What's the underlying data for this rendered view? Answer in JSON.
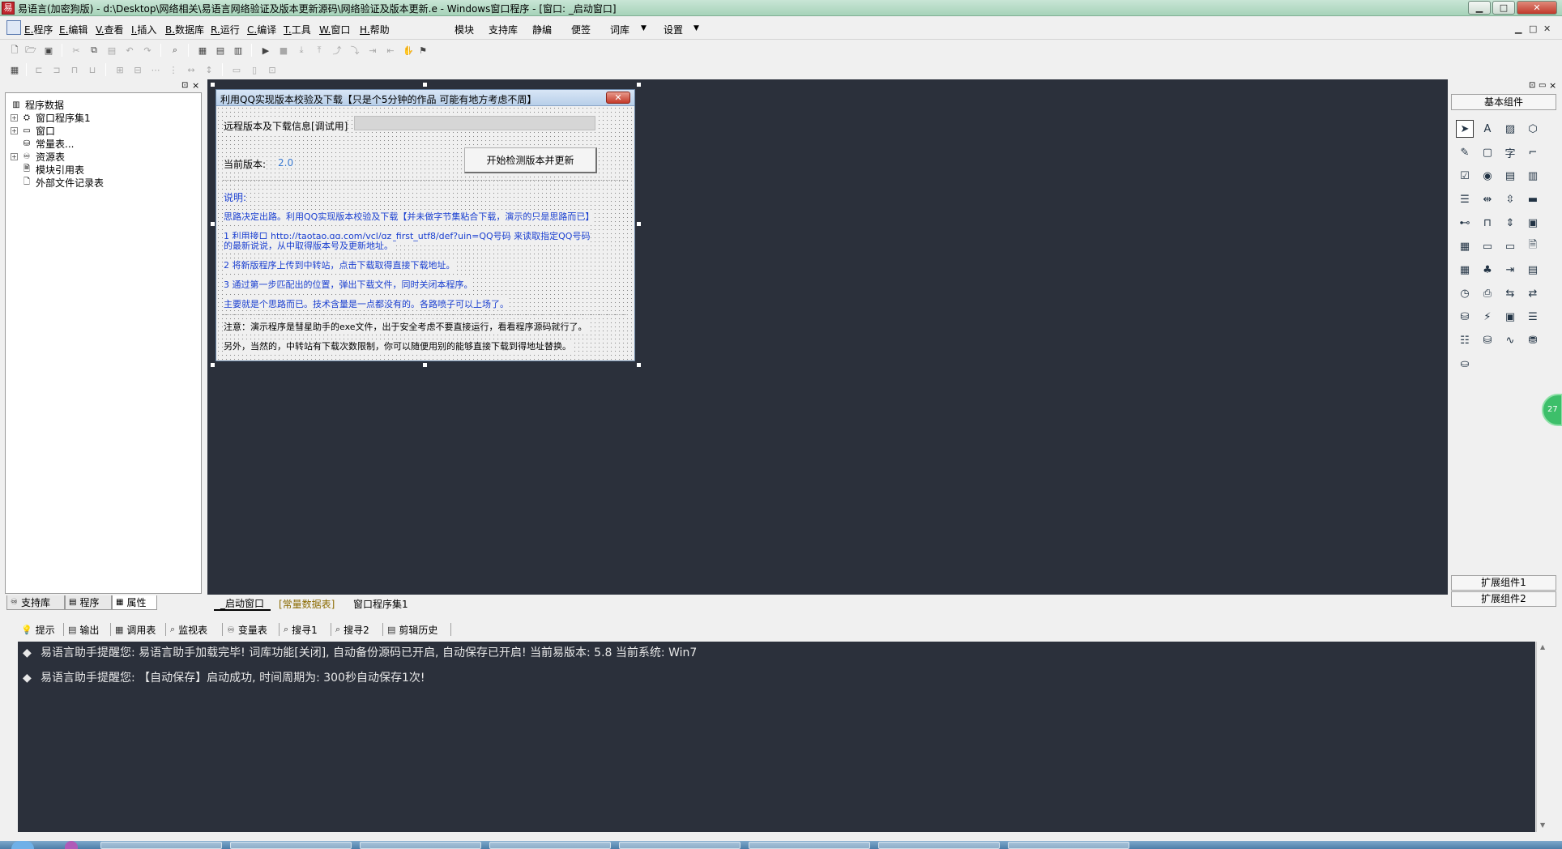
{
  "titlebar": {
    "title": "易语言(加密狗版) - d:\\Desktop\\网络相关\\易语言网络验证及版本更新源码\\网络验证及版本更新.e - Windows窗口程序 - [窗口: _启动窗口]",
    "minimize": "▁",
    "maximize": "□",
    "close": "✕"
  },
  "menu": {
    "items": [
      {
        "key": "E.",
        "label": "程序"
      },
      {
        "key": "E.",
        "label": "编辑"
      },
      {
        "key": "V.",
        "label": "查看"
      },
      {
        "key": "I.",
        "label": "插入"
      },
      {
        "key": "B.",
        "label": "数据库"
      },
      {
        "key": "R.",
        "label": "运行"
      },
      {
        "key": "C.",
        "label": "编译"
      },
      {
        "key": "T.",
        "label": "工具"
      },
      {
        "key": "W.",
        "label": "窗口"
      },
      {
        "key": "H.",
        "label": "帮助"
      }
    ],
    "extras": [
      "模块",
      "支持库",
      "静编",
      "便签",
      "词库",
      "设置"
    ],
    "dropdown_glyph": "▼"
  },
  "left_panel": {
    "root": "程序数据",
    "nodes": [
      {
        "label": "窗口程序集1",
        "expander": "+"
      },
      {
        "label": "窗口",
        "expander": "+"
      },
      {
        "label": "常量表...",
        "expander": ""
      },
      {
        "label": "资源表",
        "expander": "+"
      },
      {
        "label": "模块引用表",
        "expander": ""
      },
      {
        "label": "外部文件记录表",
        "expander": ""
      }
    ],
    "tabs": [
      "支持库",
      "程序",
      "属性"
    ]
  },
  "design_tabs": [
    "_启动窗口",
    "[常量数据表]",
    "窗口程序集1"
  ],
  "form": {
    "title": "利用QQ实现版本校验及下载【只是个5分钟的作品 可能有地方考虑不周】",
    "remote_label": "远程版本及下载信息[调试用]",
    "version_label": "当前版本:",
    "version_value": "2.0",
    "check_button": "开始检测版本并更新",
    "desc_title": "说明:",
    "desc_lines": [
      "思路决定出路。利用QQ实现版本校验及下载【并未做字节集粘合下载，演示的只是思路而已】",
      "1 利用接口 http://taotao.qq.com/vcl/qz_first_utf8/def?uin=QQ号码 来读取指定QQ号码",
      "的最新说说，从中取得版本号及更新地址。",
      "2 将新版程序上传到中转站，点击下载取得直接下载地址。",
      "3 通过第一步匹配出的位置，弹出下载文件，同时关闭本程序。",
      "主要就是个思路而已。技术含量是一点都没有的。各路喷子可以上场了。"
    ],
    "note_lines": [
      "注意：演示程序是彗星助手的exe文件，出于安全考虑不要直接运行，看看程序源码就行了。",
      "另外，当然的，中转站有下载次数限制，你可以随便用别的能够直接下载到得地址替换。"
    ]
  },
  "right_panel": {
    "header": "基本组件",
    "ext1": "扩展组件1",
    "ext2": "扩展组件2",
    "badge": "27"
  },
  "output_tabs": [
    "提示",
    "输出",
    "调用表",
    "监视表",
    "变量表",
    "搜寻1",
    "搜寻2",
    "剪辑历史"
  ],
  "output_lines": [
    "易语言助手提醒您:  易语言助手加载完毕! 词库功能[关闭], 自动备份源码已开启, 自动保存已开启!  当前易版本: 5.8  当前系统: Win7",
    "易语言助手提醒您: 【自动保存】启动成功, 时间周期为: 300秒自动保存1次!"
  ],
  "colors": {
    "dark_bg": "#2b303b",
    "title_green": "#a6d3b9",
    "form_blue_text": "#1a3fd0"
  }
}
